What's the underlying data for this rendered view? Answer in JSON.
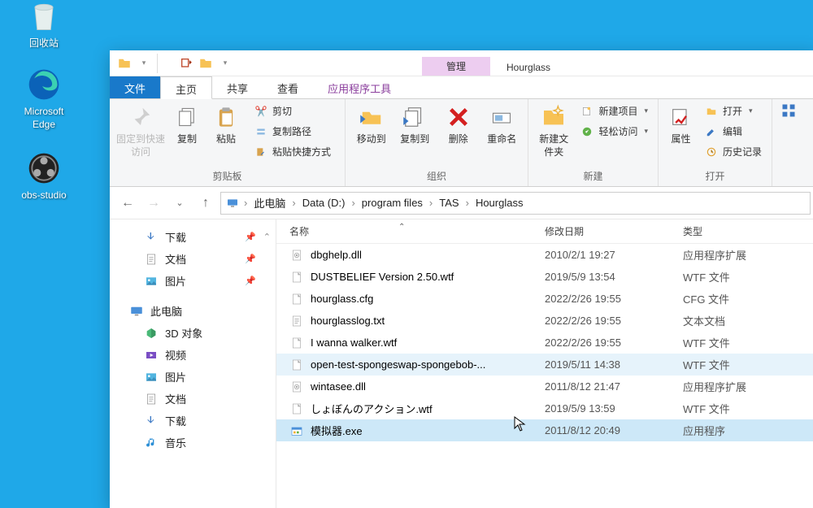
{
  "desktop": {
    "recycle": "回收站",
    "edge": "Microsoft Edge",
    "obs": "obs-studio"
  },
  "titlebar": {
    "context_tab": "管理",
    "folder": "Hourglass"
  },
  "tabs": {
    "file": "文件",
    "home": "主页",
    "share": "共享",
    "view": "查看",
    "apptools": "应用程序工具"
  },
  "ribbon": {
    "pin": "固定到快速访问",
    "copy": "复制",
    "paste": "粘贴",
    "cut": "剪切",
    "copypath": "复制路径",
    "pasteshortcut": "粘贴快捷方式",
    "group_clipboard": "剪贴板",
    "moveto": "移动到",
    "copyto": "复制到",
    "delete": "删除",
    "rename": "重命名",
    "group_organize": "组织",
    "newfolder": "新建文件夹",
    "newitem": "新建项目",
    "easyaccess": "轻松访问",
    "group_new": "新建",
    "properties": "属性",
    "open": "打开",
    "edit": "编辑",
    "history": "历史记录",
    "group_open": "打开"
  },
  "breadcrumb": {
    "pc": "此电脑",
    "drive": "Data (D:)",
    "pf": "program files",
    "tas": "TAS",
    "hg": "Hourglass"
  },
  "nav": {
    "downloads": "下载",
    "documents": "文档",
    "pictures": "图片",
    "thispc": "此电脑",
    "objects3d": "3D 对象",
    "videos": "视频",
    "pictures2": "图片",
    "documents2": "文档",
    "downloads2": "下载",
    "music": "音乐"
  },
  "columns": {
    "name": "名称",
    "date": "修改日期",
    "type": "类型"
  },
  "files": [
    {
      "name": "dbghelp.dll",
      "date": "2010/2/1 19:27",
      "type": "应用程序扩展",
      "icon": "dll"
    },
    {
      "name": "DUSTBELIEF Version 2.50.wtf",
      "date": "2019/5/9 13:54",
      "type": "WTF 文件",
      "icon": "file"
    },
    {
      "name": "hourglass.cfg",
      "date": "2022/2/26 19:55",
      "type": "CFG 文件",
      "icon": "file"
    },
    {
      "name": "hourglasslog.txt",
      "date": "2022/2/26 19:55",
      "type": "文本文档",
      "icon": "txt"
    },
    {
      "name": "I wanna walker.wtf",
      "date": "2022/2/26 19:55",
      "type": "WTF 文件",
      "icon": "file"
    },
    {
      "name": "open-test-spongeswap-spongebob-...",
      "date": "2019/5/11 14:38",
      "type": "WTF 文件",
      "icon": "file",
      "hover": true
    },
    {
      "name": "wintasee.dll",
      "date": "2011/8/12 21:47",
      "type": "应用程序扩展",
      "icon": "dll"
    },
    {
      "name": "しょぼんのアクション.wtf",
      "date": "2019/5/9 13:59",
      "type": "WTF 文件",
      "icon": "file"
    },
    {
      "name": "模拟器.exe",
      "date": "2011/8/12 20:49",
      "type": "应用程序",
      "icon": "exe",
      "selected": true
    }
  ]
}
